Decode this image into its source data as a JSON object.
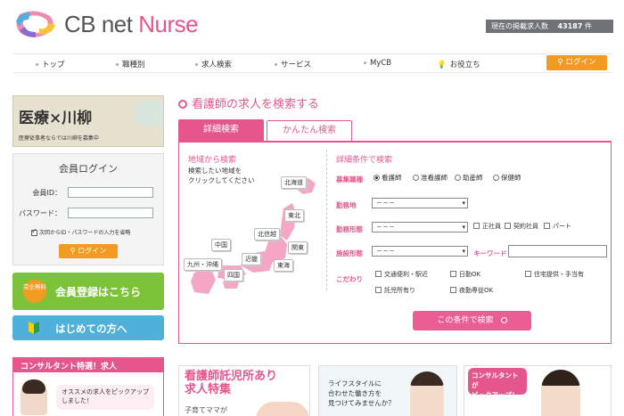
{
  "brand": {
    "logo_main": "CB net",
    "logo_accent": "Nurse"
  },
  "header": {
    "job_count_label": "現在の掲載求人数",
    "job_count_value": "43187",
    "job_count_unit": "件"
  },
  "nav": {
    "items": [
      "トップ",
      "職種別",
      "求人検索",
      "サービス",
      "MyCB",
      "お役立ち"
    ],
    "login_label": "ログイン"
  },
  "sidebar": {
    "senryu_title": "医療×川柳",
    "senryu_sub": "医療従事者ならでは川柳を募集中",
    "login": {
      "title": "会員ログイン",
      "id_label": "会員ID：",
      "pw_label": "パスワード：",
      "remember_label": "次回からID・パスワードの入力を省略",
      "button_label": "ログイン"
    },
    "register": {
      "badge": "完全無料",
      "label": "会員登録はこちら"
    },
    "first_time": "はじめての方へ",
    "consultant": {
      "header": "コンサルタント特選！求人",
      "message": "オススメの求人をピックアップしました！"
    }
  },
  "search": {
    "title": "看護師の求人を検索する",
    "tabs": [
      "詳細検索",
      "かんたん検索"
    ],
    "area_title": "地域から検索",
    "area_desc_1": "検索したい地域を",
    "area_desc_2": "クリックしてください",
    "regions": [
      "北海道",
      "東北",
      "北信越",
      "関東",
      "中国",
      "近畿",
      "東海",
      "九州・沖縄",
      "四国"
    ],
    "cond_title": "詳細条件で検索",
    "fields": {
      "job_type": "募集職種",
      "location": "勤務地",
      "work_style": "勤務形態",
      "facility": "施設形態",
      "preference": "こだわり",
      "keyword": "キーワード"
    },
    "job_types": [
      "看護師",
      "准看護師",
      "助産師",
      "保健師"
    ],
    "select_placeholder": "－－－",
    "work_styles": [
      "正社員",
      "契約社員",
      "パート"
    ],
    "preferences": [
      "交通便利・駅近",
      "日勤OK",
      "住宅提供・手当有",
      "託児所有り",
      "夜勤専従OK"
    ],
    "submit_label": "この条件で検索"
  },
  "banners": {
    "b1_title_1": "看護師託児所あり",
    "b1_title_2": "求人特集",
    "b1_sub": "子育てママが",
    "b2_text_1": "ライフスタイルに",
    "b2_text_2": "合わせた働き方を",
    "b2_text_3": "見つけてみませんか？",
    "b3_bubble_1": "コンサルタントが",
    "b3_bubble_2": "ピックアップ！"
  },
  "colors": {
    "accent": "#e5578c",
    "orange": "#f39a22",
    "green": "#7cc33a",
    "blue": "#4fb0d9"
  }
}
